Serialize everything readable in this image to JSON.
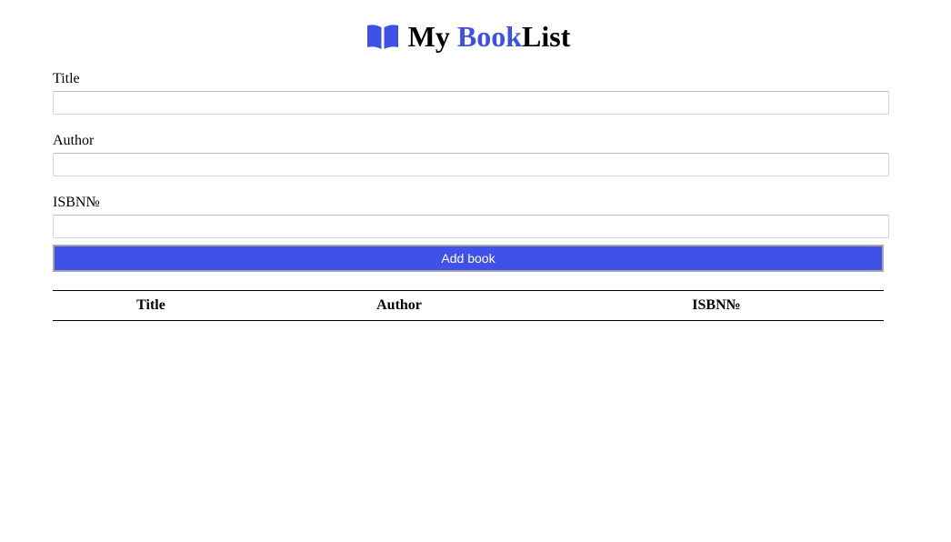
{
  "header": {
    "icon": "open-book-icon",
    "title_part1": "My ",
    "title_part2": "Book",
    "title_part3": "List",
    "accent_color": "#3f51e4"
  },
  "form": {
    "title_label": "Title",
    "title_value": "",
    "author_label": "Author",
    "author_value": "",
    "isbn_label": "ISBN№",
    "isbn_value": "",
    "submit_label": "Add book",
    "submit_color": "#3f51e8"
  },
  "table": {
    "columns": [
      "Title",
      "Author",
      "ISBN№"
    ],
    "rows": []
  }
}
